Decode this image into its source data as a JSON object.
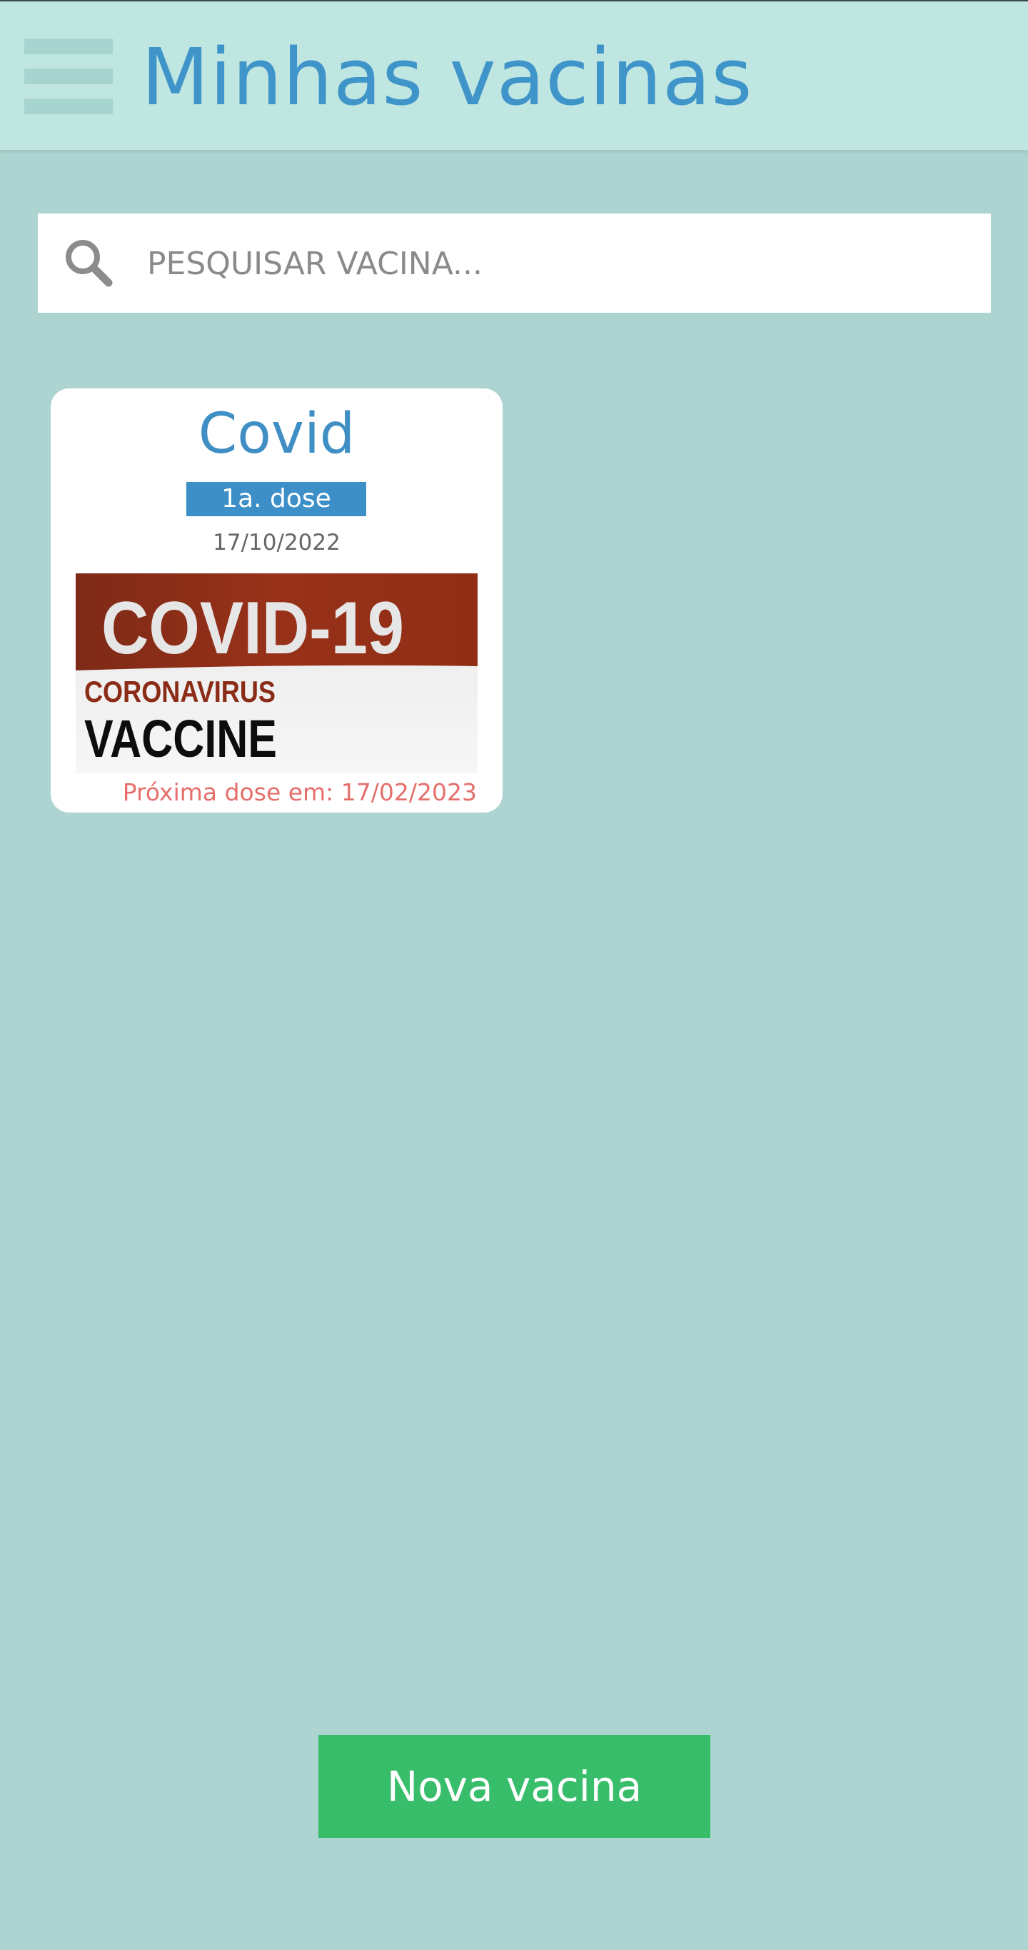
{
  "header": {
    "title": "Minhas vacinas",
    "menu_icon": "hamburger-menu-icon"
  },
  "search": {
    "placeholder": "PESQUISAR VACINA...",
    "value": "",
    "icon": "search-icon"
  },
  "vaccines": [
    {
      "name": "Covid",
      "dose": "1a. dose",
      "date": "17/10/2022",
      "image": {
        "banner_text": "COVID-19",
        "subtitle_text": "CORONAVIRUS",
        "main_text": "VACCINE"
      },
      "next_dose": "Próxima dose em: 17/02/2023"
    }
  ],
  "actions": {
    "new_vaccine_label": "Nova vacina"
  },
  "colors": {
    "background": "#add4d1",
    "header": "#c0e6e1",
    "accent_blue": "#3f95c9",
    "next_dose_red": "#e46f6b",
    "button_green": "#38bd6b"
  }
}
